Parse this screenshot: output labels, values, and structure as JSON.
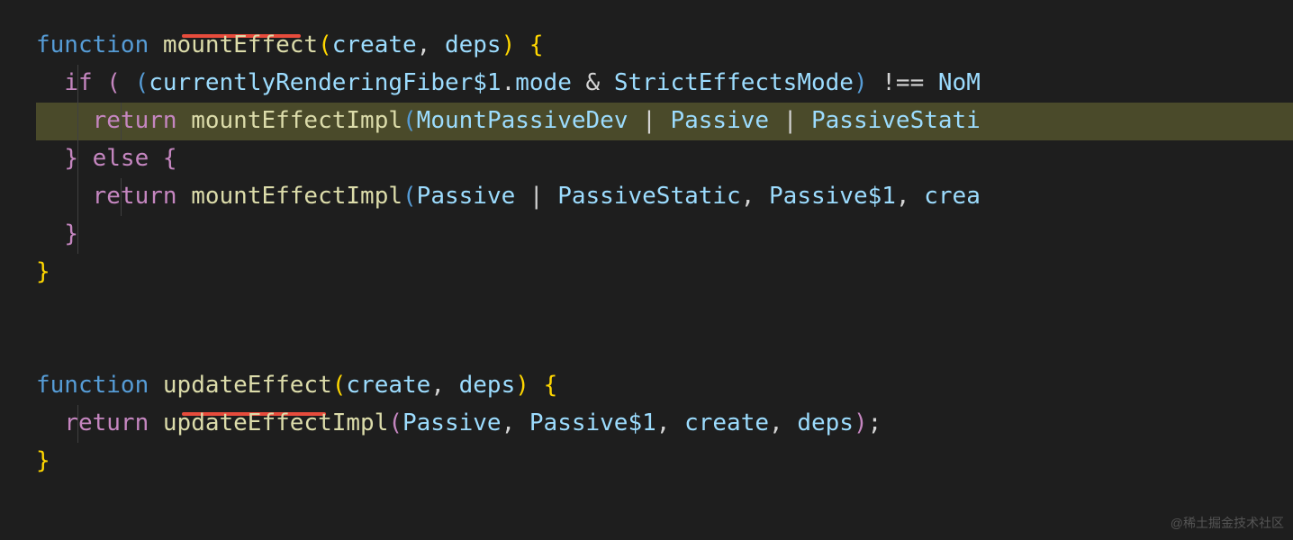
{
  "code": {
    "line1": {
      "function": "function",
      "name": "mountEffect",
      "p1": "create",
      "comma": ",",
      "p2": "deps",
      "open": "{"
    },
    "line2": {
      "if": "if",
      "var1": "currentlyRenderingFiber$1",
      "prop": "mode",
      "amp": "&",
      "var2": "StrictEffectsMode",
      "neq": "!==",
      "var3": "NoM"
    },
    "line3": {
      "return": "return",
      "fn": "mountEffectImpl",
      "a1": "MountPassiveDev",
      "pipe": "|",
      "a2": "Passive",
      "a3": "PassiveStati"
    },
    "line4": {
      "close": "}",
      "else": "else",
      "open": "{"
    },
    "line5": {
      "return": "return",
      "fn": "mountEffectImpl",
      "a1": "Passive",
      "pipe": "|",
      "a2": "PassiveStatic",
      "comma": ",",
      "a3": "Passive$1",
      "a4": "crea"
    },
    "line6": {
      "close": "}"
    },
    "line7": {
      "close": "}"
    },
    "line8": {
      "function": "function",
      "name": "updateEffect",
      "p1": "create",
      "comma": ",",
      "p2": "deps",
      "open": "{"
    },
    "line9": {
      "return": "return",
      "fn": "updateEffectImpl",
      "a1": "Passive",
      "comma": ",",
      "a2": "Passive$1",
      "a3": "create",
      "a4": "deps",
      "semi": ";"
    },
    "line10": {
      "close": "}"
    }
  },
  "watermark": "@稀土掘金技术社区"
}
